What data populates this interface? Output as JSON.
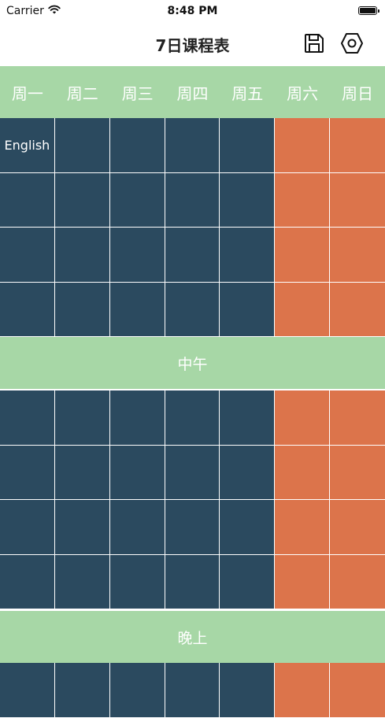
{
  "status_bar": {
    "carrier": "Carrier",
    "time": "8:48 PM"
  },
  "nav": {
    "title": "7日课程表",
    "save_icon": "save-icon",
    "settings_icon": "settings-icon"
  },
  "days": [
    "周一",
    "周二",
    "周三",
    "周四",
    "周五",
    "周六",
    "周日"
  ],
  "sections": {
    "noon": "中午",
    "evening": "晚上"
  },
  "morning": [
    [
      "English",
      "",
      "",
      "",
      "",
      "",
      ""
    ],
    [
      "",
      "",
      "",
      "",
      "",
      "",
      ""
    ],
    [
      "",
      "",
      "",
      "",
      "",
      "",
      ""
    ],
    [
      "",
      "",
      "",
      "",
      "",
      "",
      ""
    ]
  ],
  "afternoon": [
    [
      "",
      "",
      "",
      "",
      "",
      "",
      ""
    ],
    [
      "",
      "",
      "",
      "",
      "",
      "",
      ""
    ],
    [
      "",
      "",
      "",
      "",
      "",
      "",
      ""
    ],
    [
      "",
      "",
      "",
      "",
      "",
      "",
      ""
    ]
  ],
  "evening": [
    [
      "",
      "",
      "",
      "",
      "",
      "",
      ""
    ]
  ],
  "colors": {
    "header": "#a7d7a6",
    "weekday": "#2b4a5f",
    "weekend": "#dc744b"
  }
}
